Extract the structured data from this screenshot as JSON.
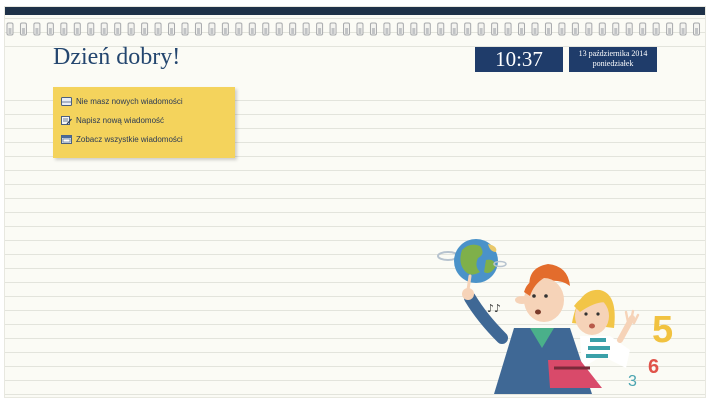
{
  "header": {
    "greeting": "Dzień dobry!",
    "time": "10:37",
    "date": "13 października 2014",
    "weekday": "poniedziałek"
  },
  "messages": {
    "items": [
      {
        "label": "Nie masz nowych wiadomości",
        "icon": "envelope-icon"
      },
      {
        "label": "Napisz nową wiadomość",
        "icon": "compose-icon"
      },
      {
        "label": "Zobacz wszystkie wiadomości",
        "icon": "inbox-icon"
      }
    ]
  },
  "illustration": {
    "numbers": [
      "5",
      "6",
      "3"
    ]
  },
  "colors": {
    "topbar": "#1e3148",
    "accent_blue": "#1f3c6a",
    "panel_yellow": "#f4d35c",
    "text_blue": "#24466f"
  }
}
